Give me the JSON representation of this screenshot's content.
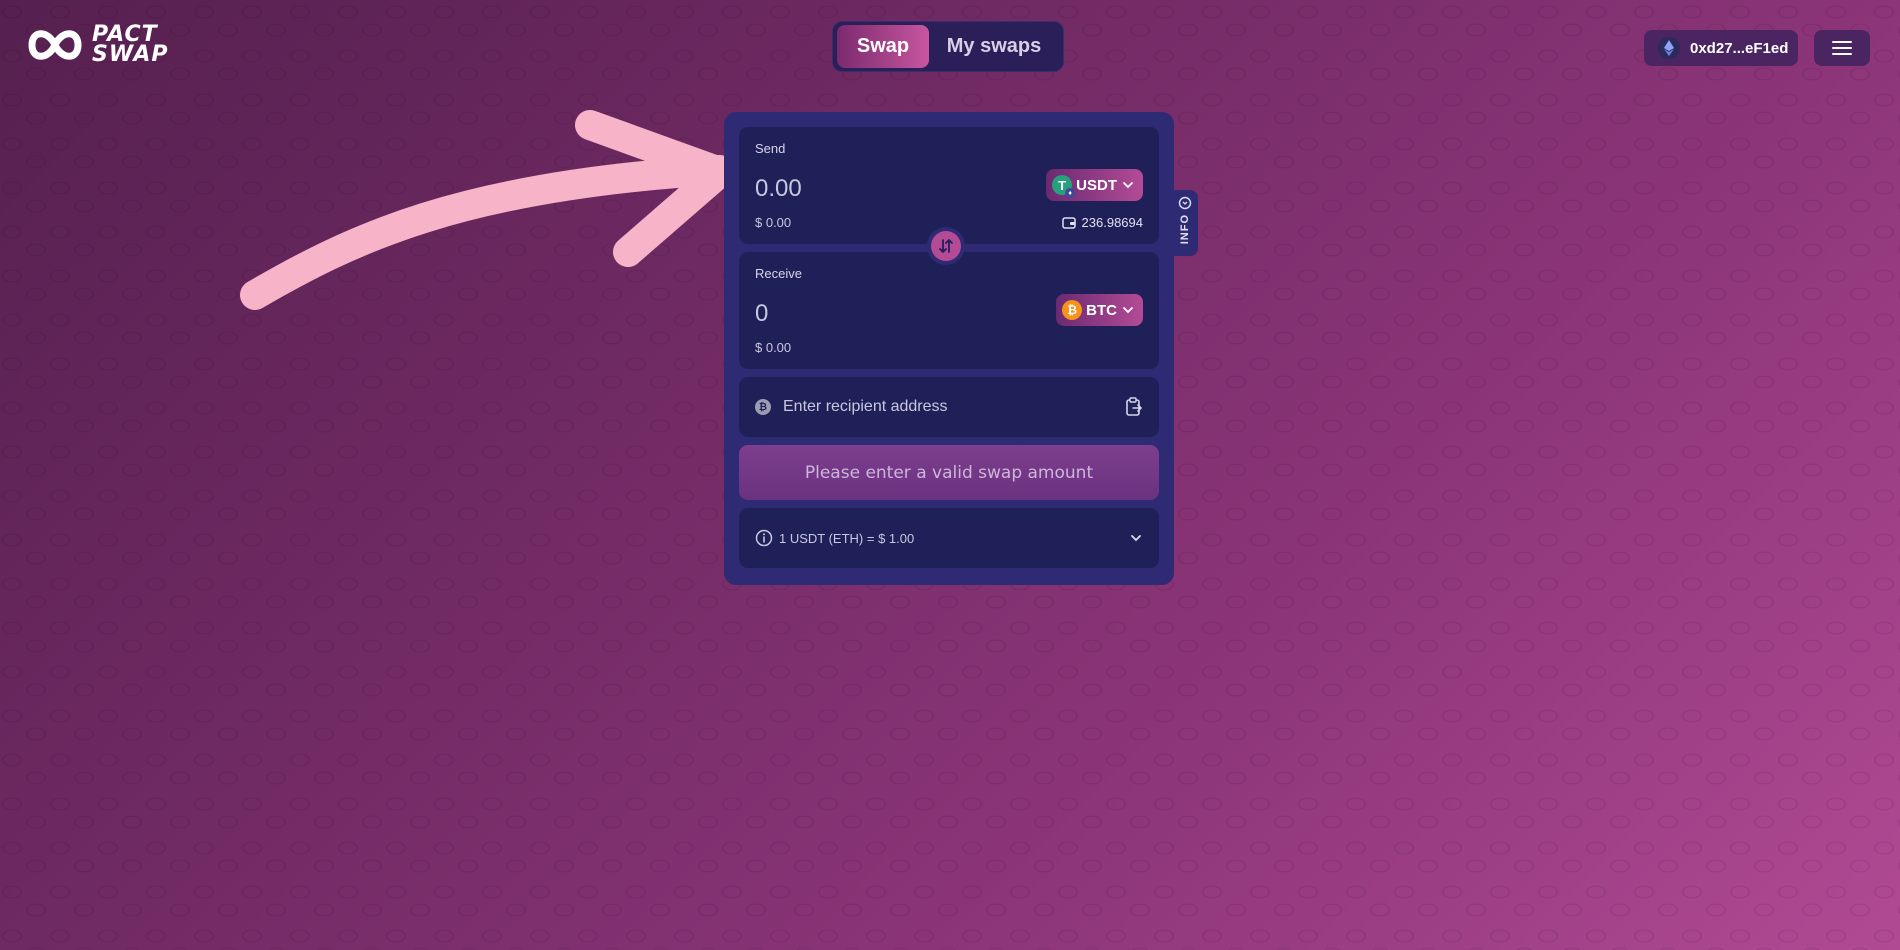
{
  "brand": {
    "logo_line1": "PACT",
    "logo_line2": "SWAP"
  },
  "nav": {
    "tabs": [
      {
        "label": "Swap",
        "active": true
      },
      {
        "label": "My swaps",
        "active": false
      }
    ]
  },
  "wallet": {
    "address": "0xd27...eF1ed",
    "icon": "ethereum-icon"
  },
  "menu": {
    "icon": "hamburger-menu-icon"
  },
  "send": {
    "label": "Send",
    "amount": "0.00",
    "usd_value": "$ 0.00",
    "token": "USDT",
    "token_icon": "tether-icon",
    "balance": "236.98694",
    "balance_icon": "wallet-icon"
  },
  "receive": {
    "label": "Receive",
    "amount": "0",
    "usd_value": "$ 0.00",
    "token": "BTC",
    "token_icon": "bitcoin-icon"
  },
  "recipient": {
    "placeholder": "Enter recipient address",
    "paste_icon": "paste-clipboard-icon"
  },
  "cta": {
    "label": "Please enter a valid swap amount"
  },
  "rate": {
    "text": "1 USDT (ETH) = $ 1.00",
    "icon": "info-icon"
  },
  "info_tab": {
    "label": "INFO"
  },
  "colors": {
    "accent": "#b44b96",
    "card": "#2f2a74",
    "panel": "#1f2057",
    "arrow": "#f7b3c8"
  }
}
